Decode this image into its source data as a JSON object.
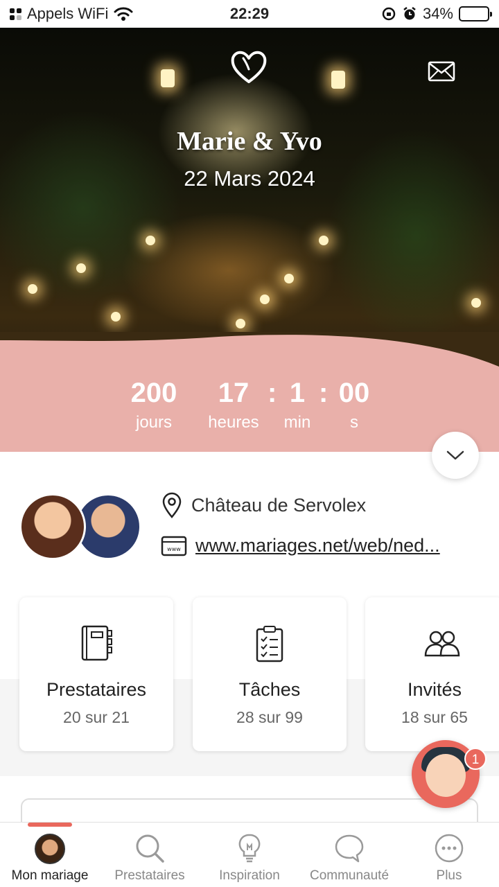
{
  "status_bar": {
    "carrier": "Appels WiFi",
    "time": "22:29",
    "battery": "34%",
    "battery_level": 0.34
  },
  "hero": {
    "couple": "Marie & Yvo",
    "date": "22 Mars 2024",
    "heart_icon": "heart-outline-icon",
    "mail_icon": "envelope-icon"
  },
  "countdown": {
    "days": "200",
    "days_label": "jours",
    "hours": "17",
    "hours_label": "heures",
    "minutes": "1",
    "minutes_label": "min",
    "seconds": "00",
    "seconds_label": "s",
    "separator": ":"
  },
  "info": {
    "location": "Château de Servolex",
    "website": "www.mariages.net/web/ned..."
  },
  "cards": [
    {
      "title": "Prestataires",
      "subtitle": "20 sur 21",
      "icon": "notebook-icon"
    },
    {
      "title": "Tâches",
      "subtitle": "28 sur 99",
      "icon": "checklist-icon"
    },
    {
      "title": "Invités",
      "subtitle": "18 sur 65",
      "icon": "guests-icon"
    }
  ],
  "chat": {
    "badge": "1"
  },
  "tabs": [
    {
      "label": "Mon mariage",
      "icon": "avatar"
    },
    {
      "label": "Prestataires",
      "icon": "search-icon"
    },
    {
      "label": "Inspiration",
      "icon": "lightbulb-icon"
    },
    {
      "label": "Communauté",
      "icon": "chat-bubble-icon"
    },
    {
      "label": "Plus",
      "icon": "more-icon"
    }
  ],
  "colors": {
    "accent": "#e9685d",
    "countdown_band": "#e9b0aa"
  }
}
